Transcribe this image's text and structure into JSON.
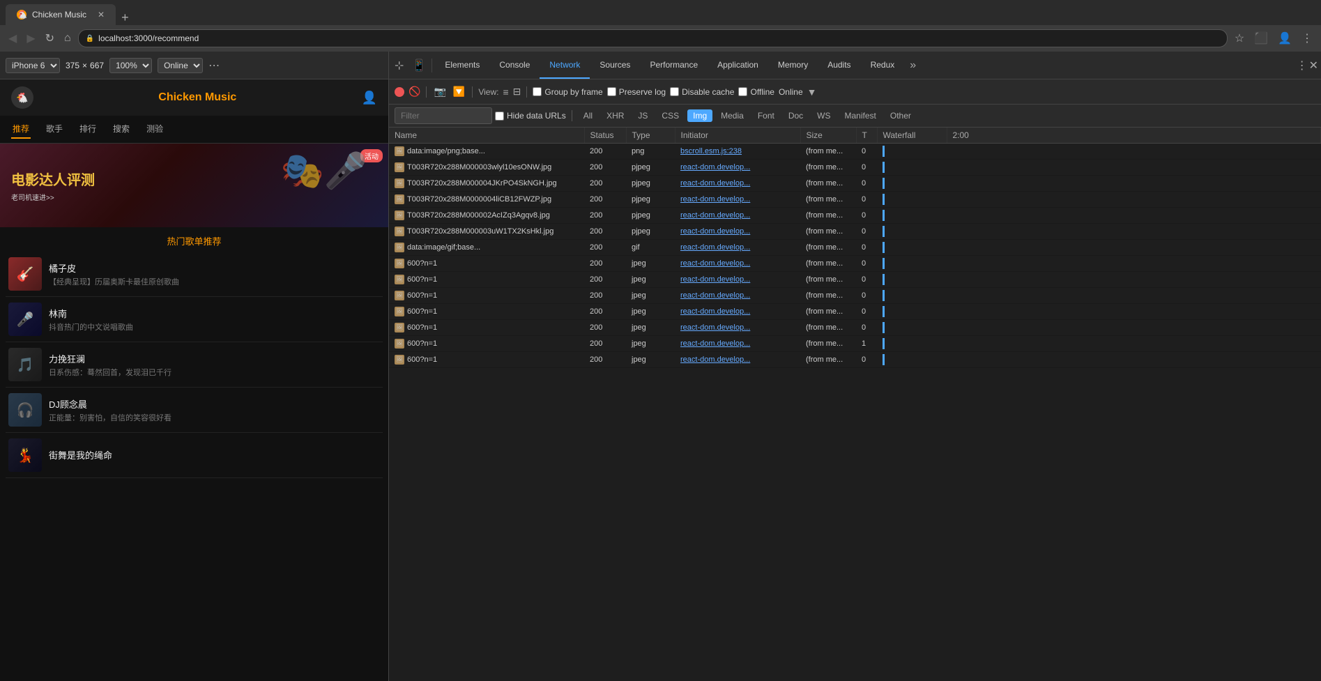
{
  "browser": {
    "url": "localhost:3000/recommend",
    "tab_title": "Chicken Music",
    "back_disabled": true,
    "forward_disabled": true
  },
  "device_toolbar": {
    "device": "iPhone 6",
    "width": "375",
    "height": "667",
    "zoom": "100%",
    "connectivity": "Online"
  },
  "app": {
    "title": "Chicken Music",
    "nav_items": [
      {
        "label": "推荐",
        "active": true
      },
      {
        "label": "歌手",
        "active": false
      },
      {
        "label": "排行",
        "active": false
      },
      {
        "label": "搜索",
        "active": false
      },
      {
        "label": "测验",
        "active": false
      }
    ],
    "banner": {
      "title": "电影达人评测",
      "subtitle": "老司机速进>>",
      "badge": "活动"
    },
    "hot_section_title": "热门歌单推荐",
    "songs": [
      {
        "name": "橘子皮",
        "desc": "【经典呈现】历届奥斯卡最佳原创歌曲",
        "emoji": "🎸"
      },
      {
        "name": "林南",
        "desc": "抖音热门的中文说唱歌曲",
        "emoji": "🎤"
      },
      {
        "name": "力挽狂澜",
        "desc": "日系伤感：蓦然回首，发现泪已千行",
        "emoji": "🎵"
      },
      {
        "name": "DJ顾念晨",
        "desc": "正能量：别害怕，自信的笑容很好看",
        "emoji": "🎧"
      },
      {
        "name": "街舞是我的绳命",
        "desc": "",
        "emoji": "💃"
      }
    ]
  },
  "devtools": {
    "tabs": [
      {
        "label": "Elements",
        "active": false
      },
      {
        "label": "Console",
        "active": false
      },
      {
        "label": "Network",
        "active": true
      },
      {
        "label": "Sources",
        "active": false
      },
      {
        "label": "Performance",
        "active": false
      },
      {
        "label": "Application",
        "active": false
      },
      {
        "label": "Memory",
        "active": false
      },
      {
        "label": "Audits",
        "active": false
      },
      {
        "label": "Redux",
        "active": false
      }
    ],
    "network": {
      "toolbar": {
        "view_label": "View:",
        "group_by_frame_label": "Group by frame",
        "preserve_log_label": "Preserve log",
        "disable_cache_label": "Disable cache",
        "offline_label": "Offline",
        "online_label": "Online"
      },
      "filter_tabs": [
        "All",
        "XHR",
        "JS",
        "CSS",
        "Img",
        "Media",
        "Font",
        "Doc",
        "WS",
        "Manifest",
        "Other"
      ],
      "active_filter": "Img",
      "filter_placeholder": "Filter",
      "hide_data_urls": "Hide data URLs",
      "columns": [
        "Name",
        "Status",
        "Type",
        "Initiator",
        "Size",
        "T",
        "Waterfall"
      ],
      "rows": [
        {
          "name": "data:image/png;base...",
          "status": "200",
          "type": "png",
          "initiator": "bscroll.esm.js:238",
          "size": "(from me...",
          "t": "0",
          "waterfall": true,
          "icon": "img"
        },
        {
          "name": "T003R720x288M000003wlyl10esONW.jpg",
          "status": "200",
          "type": "pjpeg",
          "initiator": "react-dom.develop...",
          "size": "(from me...",
          "t": "0",
          "waterfall": true,
          "icon": "img"
        },
        {
          "name": "T003R720x288M000004JKrPO4SkNGH.jpg",
          "status": "200",
          "type": "pjpeg",
          "initiator": "react-dom.develop...",
          "size": "(from me...",
          "t": "0",
          "waterfall": true,
          "icon": "img"
        },
        {
          "name": "T003R720x288M0000004liCB12FWZP.jpg",
          "status": "200",
          "type": "pjpeg",
          "initiator": "react-dom.develop...",
          "size": "(from me...",
          "t": "0",
          "waterfall": true,
          "icon": "img"
        },
        {
          "name": "T003R720x288M000002AcIZq3Agqv8.jpg",
          "status": "200",
          "type": "pjpeg",
          "initiator": "react-dom.develop...",
          "size": "(from me...",
          "t": "0",
          "waterfall": true,
          "icon": "img"
        },
        {
          "name": "T003R720x288M000003uW1TX2KsHkl.jpg",
          "status": "200",
          "type": "pjpeg",
          "initiator": "react-dom.develop...",
          "size": "(from me...",
          "t": "0",
          "waterfall": true,
          "icon": "img"
        },
        {
          "name": "data:image/gif;base...",
          "status": "200",
          "type": "gif",
          "initiator": "react-dom.develop...",
          "size": "(from me...",
          "t": "0",
          "waterfall": true,
          "icon": "img"
        },
        {
          "name": "600?n=1",
          "status": "200",
          "type": "jpeg",
          "initiator": "react-dom.develop...",
          "size": "(from me...",
          "t": "0",
          "waterfall": true,
          "icon": "img"
        },
        {
          "name": "600?n=1",
          "status": "200",
          "type": "jpeg",
          "initiator": "react-dom.develop...",
          "size": "(from me...",
          "t": "0",
          "waterfall": true,
          "icon": "img"
        },
        {
          "name": "600?n=1",
          "status": "200",
          "type": "jpeg",
          "initiator": "react-dom.develop...",
          "size": "(from me...",
          "t": "0",
          "waterfall": true,
          "icon": "img"
        },
        {
          "name": "600?n=1",
          "status": "200",
          "type": "jpeg",
          "initiator": "react-dom.develop...",
          "size": "(from me...",
          "t": "0",
          "waterfall": true,
          "icon": "img"
        },
        {
          "name": "600?n=1",
          "status": "200",
          "type": "jpeg",
          "initiator": "react-dom.develop...",
          "size": "(from me...",
          "t": "0",
          "waterfall": true,
          "icon": "img"
        },
        {
          "name": "600?n=1",
          "status": "200",
          "type": "jpeg",
          "initiator": "react-dom.develop...",
          "size": "(from me...",
          "t": "1",
          "waterfall": true,
          "icon": "img"
        },
        {
          "name": "600?n=1",
          "status": "200",
          "type": "jpeg",
          "initiator": "react-dom.develop...",
          "size": "(from me...",
          "t": "0",
          "waterfall": true,
          "icon": "img"
        }
      ]
    }
  }
}
